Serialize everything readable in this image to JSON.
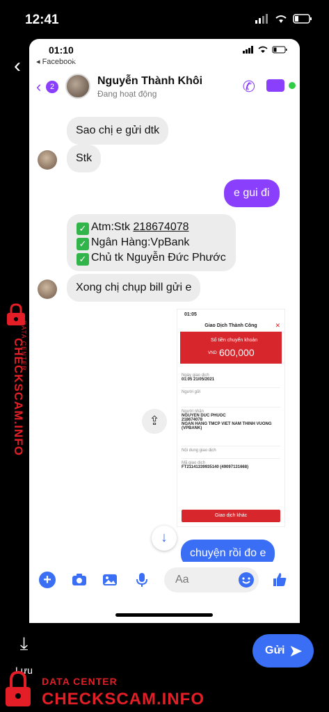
{
  "outer_status": {
    "time": "12:41"
  },
  "inner_status": {
    "time": "01:10",
    "back_app": "◂ Facebook"
  },
  "conversation": {
    "badge": "2",
    "name": "Nguyễn Thành Khôi",
    "status": "Đang hoạt động"
  },
  "messages": {
    "m1": "Sao chị e gửi dtk",
    "m2": "Stk",
    "m3": "e gui đi",
    "m4_line1_prefix": "Atm:Stk ",
    "m4_line1_acct": "218674078",
    "m4_line2": "Ngân Hàng:VpBank",
    "m4_line3": "Chủ tk Nguyễn Đức Phước",
    "m5": "Xong chị chụp bill gửi e",
    "m6": "chuyện rồi đo e"
  },
  "receipt": {
    "time": "01:05",
    "title": "Giao Dịch Thành Công",
    "amount_label": "Số tiền chuyển khoản",
    "currency": "VND",
    "amount": "600,000",
    "date_label": "Ngày giao dịch",
    "date_value": "01:05 21/05/2021",
    "sender_label": "Người gửi",
    "recipient_label": "Người nhận",
    "recipient_name": "NGUYEN DUC PHUOC",
    "recipient_account": "218674078",
    "recipient_bank": "NGAN HANG TMCP VIET NAM THINH VUONG (VPBANK)",
    "content_label": "Nội dung giao dịch",
    "txid_label": "Mã giao dịch",
    "txid_value": "FT21141339935140 (49097131668)",
    "other_button": "Giao dịch khác"
  },
  "composer": {
    "placeholder": "Aa"
  },
  "editor": {
    "text_tool": "Aa"
  },
  "actions": {
    "save_label": "Lưu",
    "send_label": "Gửi"
  },
  "watermark": {
    "side_small": "DATA CENTER",
    "side_main": "CHECKSCAM.INFO",
    "bottom_small": "DATA CENTER",
    "bottom_main": "CHECKSCAM.INFO"
  },
  "colors": {
    "messenger_purple": "#8a3ffc",
    "messenger_blue": "#3a6ef5",
    "watermark_red": "#e41e26",
    "receipt_red": "#d7262c"
  }
}
